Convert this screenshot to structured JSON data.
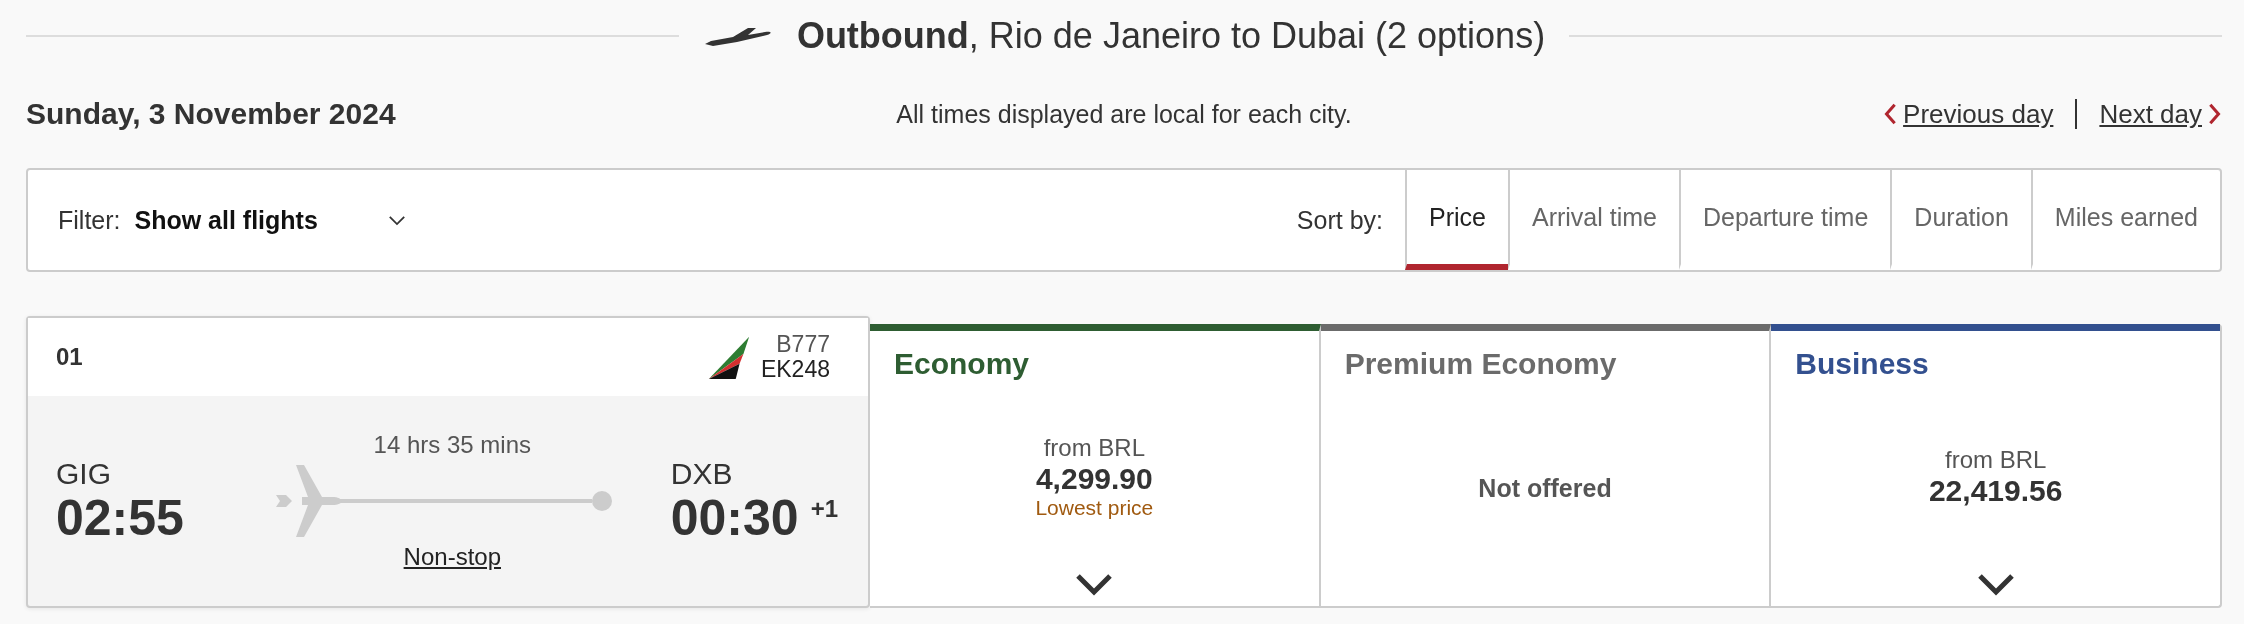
{
  "header": {
    "direction": "Outbound",
    "route": ", Rio de Janeiro to Dubai (2 options)"
  },
  "date": "Sunday, 3 November 2024",
  "note": "All times displayed are local for each city.",
  "day_nav": {
    "previous": "Previous day",
    "next": "Next day"
  },
  "filter": {
    "label": "Filter:",
    "value": "Show all flights"
  },
  "sort": {
    "label": "Sort by:",
    "options": [
      {
        "label": "Price",
        "selected": true
      },
      {
        "label": "Arrival time",
        "selected": false
      },
      {
        "label": "Departure time",
        "selected": false
      },
      {
        "label": "Duration",
        "selected": false
      },
      {
        "label": "Miles earned",
        "selected": false
      }
    ]
  },
  "flight": {
    "number_label": "01",
    "aircraft": "B777",
    "flight_no": "EK248",
    "origin": "GIG",
    "departure": "02:55",
    "duration": "14 hrs 35 mins",
    "stops": "Non-stop",
    "destination": "DXB",
    "arrival": "00:30",
    "day_offset": "+1"
  },
  "fares": [
    {
      "kind": "price",
      "name": "Economy",
      "color": "#2e5d32",
      "from": "from BRL",
      "amount": "4,299.90",
      "tag": "Lowest price"
    },
    {
      "kind": "unavailable",
      "name": "Premium Economy",
      "color": "#6b6b6b",
      "status": "Not offered"
    },
    {
      "kind": "price",
      "name": "Business",
      "color": "#33508f",
      "from": "from BRL",
      "amount": "22,419.56"
    }
  ]
}
